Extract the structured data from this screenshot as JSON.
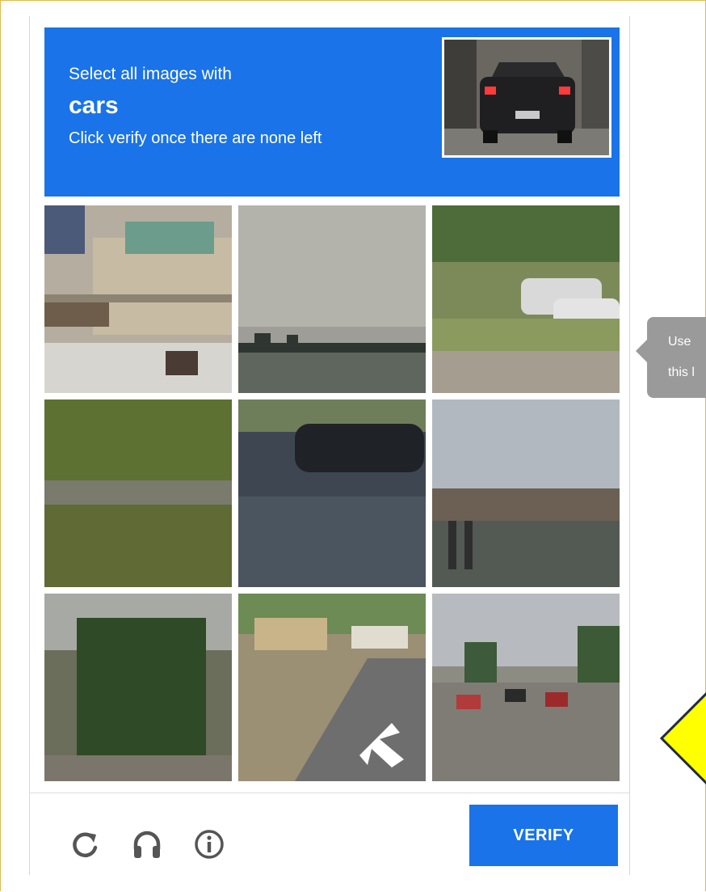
{
  "challenge": {
    "instruction": "Select all images with",
    "target": "cars",
    "hint": "Click verify once there are none left",
    "sample_image": "rear of dark hatchback car on street"
  },
  "grid": {
    "tiles": [
      {
        "image": "storefront building at street corner"
      },
      {
        "image": "noisy grey sky over ship silhouette"
      },
      {
        "image": "parked white cars beside trees"
      },
      {
        "image": "green hillside with grass"
      },
      {
        "image": "dark car on shaded road"
      },
      {
        "image": "highway overpass underside"
      },
      {
        "image": "palm tree by building"
      },
      {
        "image": "curved street with turn arrow"
      },
      {
        "image": "street traffic with red cars"
      }
    ]
  },
  "footer": {
    "reload_icon": "reload-icon",
    "audio_icon": "headphones-icon",
    "info_icon": "info-icon",
    "verify_label": "VERIFY"
  },
  "tooltip": {
    "line1": "Use",
    "line2": "this l"
  },
  "colors": {
    "brand_blue": "#1a73e8",
    "tooltip_grey": "#9a9a9a",
    "highlight_yellow": "#ffff00"
  }
}
